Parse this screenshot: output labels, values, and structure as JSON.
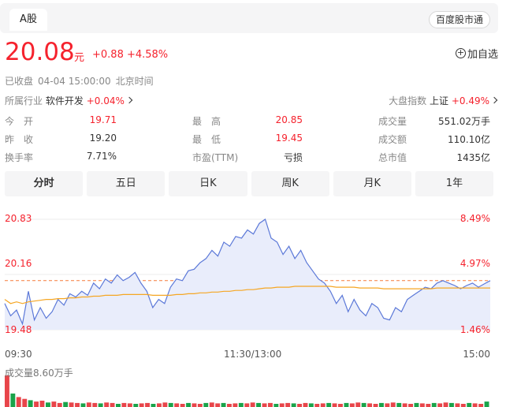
{
  "header": {
    "tab_label": "A股",
    "brand": "百度股市通"
  },
  "quote": {
    "price": "20.08",
    "unit": "元",
    "change": "+0.88 +4.58%",
    "add_label": "加自选",
    "status": "已收盘",
    "time": "04-04 15:00:00",
    "timezone": "北京时间"
  },
  "industry": {
    "label": "所属行业",
    "name": "软件开发",
    "change": "+0.04%",
    "index_label": "大盘指数",
    "index_name": "上证",
    "index_change": "+0.49%"
  },
  "stats": [
    {
      "label": "今　开",
      "value": "19.71",
      "color": "#f5222d"
    },
    {
      "label": "最　高",
      "value": "20.85",
      "color": "#f5222d"
    },
    {
      "label": "成交量",
      "value": "551.02万手",
      "color": "#333333"
    },
    {
      "label": "昨　收",
      "value": "19.20",
      "color": "#333333"
    },
    {
      "label": "最　低",
      "value": "19.45",
      "color": "#f5222d"
    },
    {
      "label": "成交额",
      "value": "110.10亿",
      "color": "#333333"
    },
    {
      "label": "换手率",
      "value": "7.71%",
      "color": "#333333"
    },
    {
      "label": "市盈(TTM)",
      "value": "亏损",
      "color": "#333333"
    },
    {
      "label": "总市值",
      "value": "1435亿",
      "color": "#333333"
    }
  ],
  "tabs": [
    "分时",
    "五日",
    "日K",
    "周K",
    "月K",
    "1年"
  ],
  "chart_data": {
    "type": "line",
    "y_left_ticks": [
      "20.83",
      "20.16",
      "19.48"
    ],
    "y_right_ticks": [
      "8.49%",
      "4.97%",
      "1.46%"
    ],
    "x_ticks": [
      "09:30",
      "11:30/13:00",
      "15:00"
    ],
    "ylim": [
      19.48,
      20.83
    ],
    "prev_close": 19.2,
    "ref_line": 20.08,
    "volume_label": "成交量8.60万手",
    "series": [
      {
        "values": [
          19.8,
          19.65,
          19.72,
          19.55,
          19.95,
          19.6,
          19.75,
          19.62,
          19.7,
          19.85,
          19.78,
          19.92,
          19.88,
          19.95,
          19.9,
          20.05,
          19.98,
          20.1,
          20.05,
          20.15,
          20.08,
          20.12,
          20.18,
          20.05,
          19.95,
          19.75,
          19.85,
          19.8,
          20.0,
          20.1,
          20.08,
          20.2,
          20.22,
          20.3,
          20.35,
          20.45,
          20.38,
          20.55,
          20.5,
          20.62,
          20.6,
          20.7,
          20.65,
          20.78,
          20.83,
          20.6,
          20.55,
          20.4,
          20.5,
          20.35,
          20.45,
          20.3,
          20.2,
          20.1,
          20.05,
          19.95,
          19.8,
          19.9,
          19.7,
          19.85,
          19.72,
          19.65,
          19.8,
          19.75,
          19.62,
          19.6,
          19.75,
          19.7,
          19.85,
          19.9,
          19.95,
          20.0,
          19.98,
          20.05,
          20.08,
          20.05,
          20.02,
          19.98,
          20.02,
          20.05,
          20.0,
          20.04,
          20.08
        ],
        "color": "#5b78d8"
      },
      {
        "values": [
          19.85,
          19.8,
          19.82,
          19.8,
          19.82,
          19.83,
          19.84,
          19.85,
          19.85,
          19.86,
          19.86,
          19.87,
          19.87,
          19.88,
          19.88,
          19.89,
          19.89,
          19.9,
          19.9,
          19.9,
          19.91,
          19.91,
          19.91,
          19.91,
          19.91,
          19.9,
          19.9,
          19.9,
          19.9,
          19.91,
          19.91,
          19.92,
          19.92,
          19.93,
          19.93,
          19.94,
          19.94,
          19.95,
          19.95,
          19.96,
          19.96,
          19.97,
          19.97,
          19.98,
          19.99,
          19.99,
          20.0,
          20.0,
          20.0,
          20.01,
          20.01,
          20.01,
          20.01,
          20.01,
          20.01,
          20.01,
          20.0,
          20.0,
          20.0,
          20.0,
          19.99,
          19.99,
          19.99,
          19.99,
          19.98,
          19.98,
          19.98,
          19.98,
          19.98,
          19.98,
          19.98,
          19.98,
          19.98,
          19.99,
          19.99,
          19.99,
          19.99,
          19.99,
          19.99,
          19.99,
          19.99,
          19.99,
          19.99
        ],
        "color": "#f5a623"
      }
    ],
    "volume": [
      70,
      30,
      22,
      18,
      15,
      12,
      14,
      10,
      12,
      9,
      11,
      10,
      9,
      8,
      10,
      9,
      8,
      10,
      9,
      7,
      9,
      8,
      7,
      8,
      9,
      7,
      8,
      10,
      9,
      8,
      7,
      9,
      8,
      7,
      9,
      10,
      8,
      9,
      7,
      8,
      9,
      8,
      10,
      9,
      8,
      9,
      7,
      8,
      9,
      8,
      7,
      9,
      8,
      7,
      8,
      9,
      8,
      7,
      9,
      8,
      10,
      9,
      8,
      7,
      9,
      8,
      10,
      9,
      8,
      7,
      9,
      8,
      7,
      9,
      8,
      10,
      9,
      8,
      7,
      9,
      8,
      7,
      12
    ]
  }
}
